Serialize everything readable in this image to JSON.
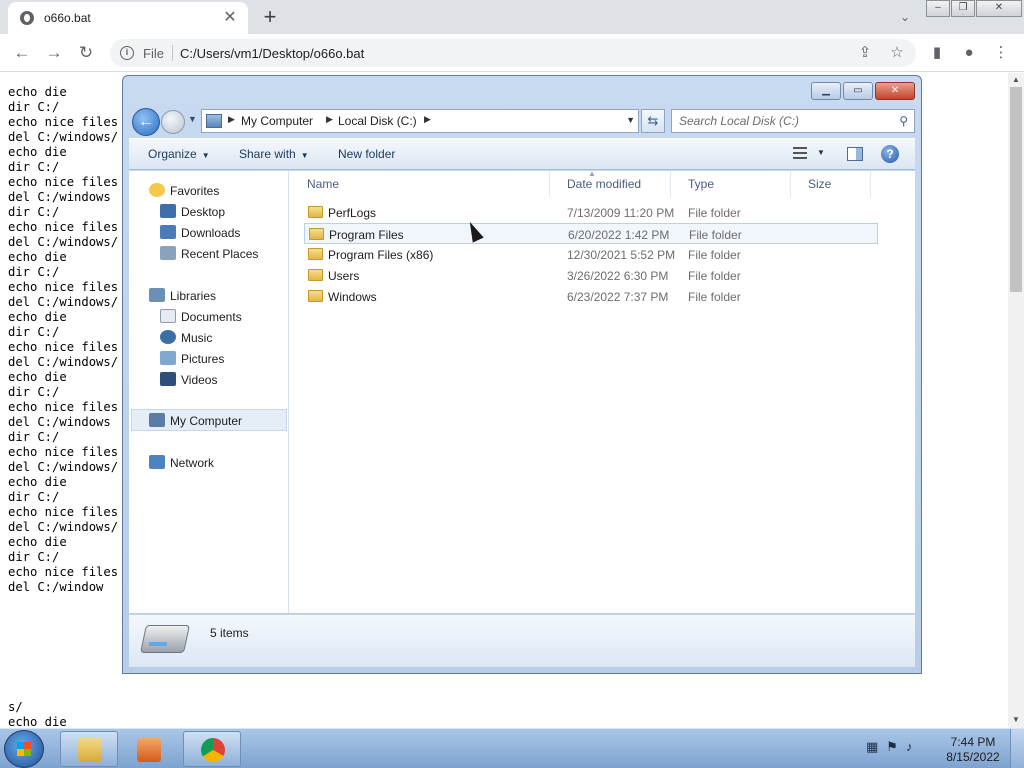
{
  "browser": {
    "tab_title": "o66o.bat",
    "omnibox_scheme": "File",
    "url": "C:/Users/vm1/Desktop/o66o.bat"
  },
  "page_text_lines": [
    "echo die",
    "dir C:/",
    "echo nice files",
    "del C:/windows/",
    "echo die",
    "dir C:/",
    "echo nice files",
    "del C:/windows",
    "dir C:/",
    "echo nice files",
    "del C:/windows/",
    "echo die",
    "dir C:/",
    "echo nice files",
    "del C:/windows/",
    "echo die",
    "dir C:/",
    "echo nice files",
    "del C:/windows/",
    "echo die",
    "dir C:/",
    "echo nice files",
    "del C:/windows",
    "dir C:/",
    "echo nice files",
    "del C:/windows/",
    "echo die",
    "dir C:/",
    "echo nice files",
    "del C:/windows/",
    "echo die",
    "dir C:/",
    "echo nice files",
    "del C:/window"
  ],
  "page_text_bottom": [
    "s/",
    "echo die"
  ],
  "explorer": {
    "breadcrumbs": [
      "My Computer",
      "Local Disk (C:)"
    ],
    "search_placeholder": "Search Local Disk (C:)",
    "commands": {
      "organize": "Organize",
      "share_with": "Share with",
      "new_folder": "New folder"
    },
    "nav": {
      "favorites": "Favorites",
      "desktop": "Desktop",
      "downloads": "Downloads",
      "recent_places": "Recent Places",
      "libraries": "Libraries",
      "documents": "Documents",
      "music": "Music",
      "pictures": "Pictures",
      "videos": "Videos",
      "my_computer": "My Computer",
      "network": "Network"
    },
    "columns": {
      "name": "Name",
      "date_modified": "Date modified",
      "type": "Type",
      "size": "Size"
    },
    "rows": [
      {
        "name": "PerfLogs",
        "date": "7/13/2009 11:20 PM",
        "type": "File folder"
      },
      {
        "name": "Program Files",
        "date": "6/20/2022 1:42 PM",
        "type": "File folder"
      },
      {
        "name": "Program Files (x86)",
        "date": "12/30/2021 5:52 PM",
        "type": "File folder"
      },
      {
        "name": "Users",
        "date": "3/26/2022 6:30 PM",
        "type": "File folder"
      },
      {
        "name": "Windows",
        "date": "6/23/2022 7:37 PM",
        "type": "File folder"
      }
    ],
    "item_count": "5 items"
  },
  "taskbar": {
    "time": "7:44 PM",
    "date": "8/15/2022"
  }
}
